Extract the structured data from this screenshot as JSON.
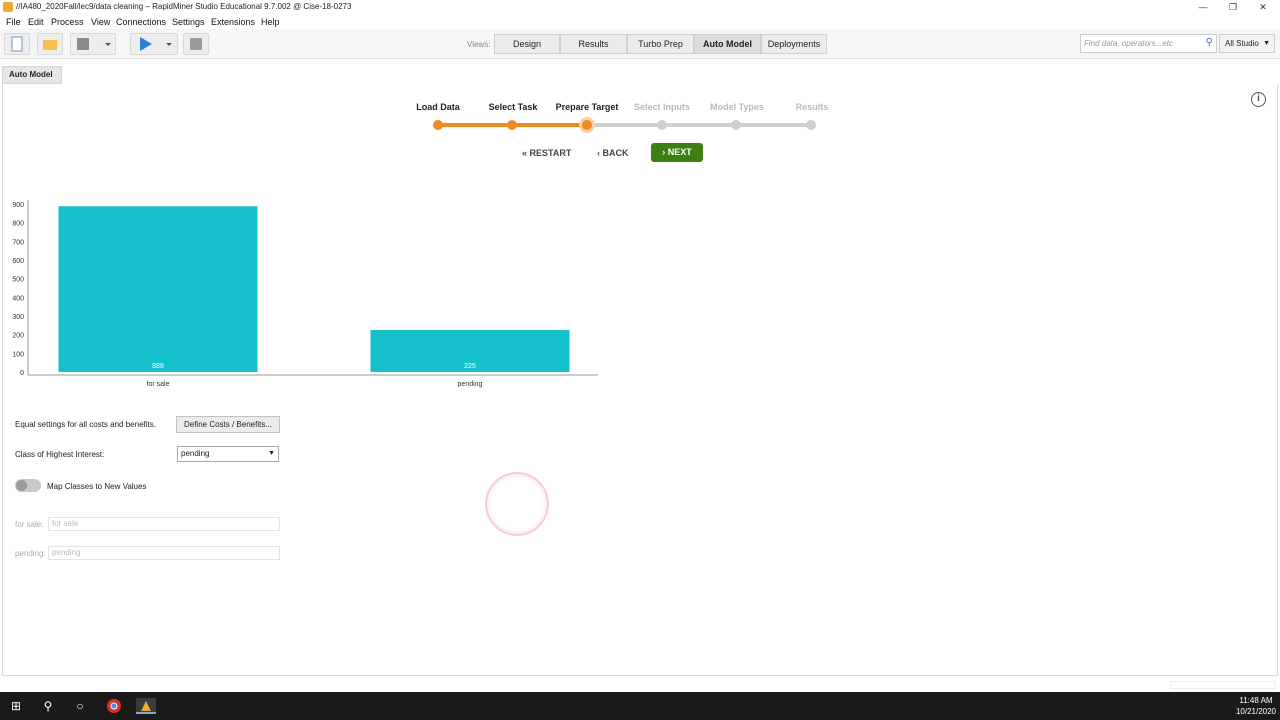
{
  "window": {
    "title": "//IA480_2020Fall/lec9/data cleaning – RapidMiner Studio Educational 9.7.002 @ Cise-18-0273",
    "minimize": "—",
    "restore": "❐",
    "close": "✕"
  },
  "menu": [
    "File",
    "Edit",
    "Process",
    "View",
    "Connections",
    "Settings",
    "Extensions",
    "Help"
  ],
  "toolbar": {
    "views_label": "Views:",
    "views": [
      "Design",
      "Results",
      "Turbo Prep",
      "Auto Model",
      "Deployments"
    ],
    "active_view": "Auto Model",
    "search_placeholder": "Find data, operators...etc",
    "perspective": "All Studio"
  },
  "panel_tab": "Auto Model",
  "wizard": {
    "steps": [
      "Load Data",
      "Select Task",
      "Prepare Target",
      "Select Inputs",
      "Model Types",
      "Results"
    ],
    "current_step": 2,
    "restart": "RESTART",
    "back": "BACK",
    "next": "NEXT"
  },
  "chart_data": {
    "type": "bar",
    "categories": [
      "for sale",
      "pending"
    ],
    "values": [
      888,
      225
    ],
    "value_labels": [
      "888",
      "225"
    ],
    "ylim": [
      0,
      900
    ],
    "yticks": [
      "0",
      "100",
      "200",
      "300",
      "400",
      "500",
      "600",
      "700",
      "800",
      "900"
    ],
    "color": "#17c1cc",
    "grid": false,
    "legend": "none"
  },
  "form": {
    "costs_label": "Equal settings for all costs and benefits.",
    "define_button": "Define Costs / Benefits...",
    "class_label": "Class of Highest Interest:",
    "class_value": "pending",
    "map_toggle_label": "Map Classes to New Values",
    "map_rows": [
      {
        "label": "for sale:",
        "value": "for sale"
      },
      {
        "label": "pending:",
        "value": "pending"
      }
    ]
  },
  "taskbar": {
    "time": "11:48 AM",
    "date": "10/21/2020"
  }
}
